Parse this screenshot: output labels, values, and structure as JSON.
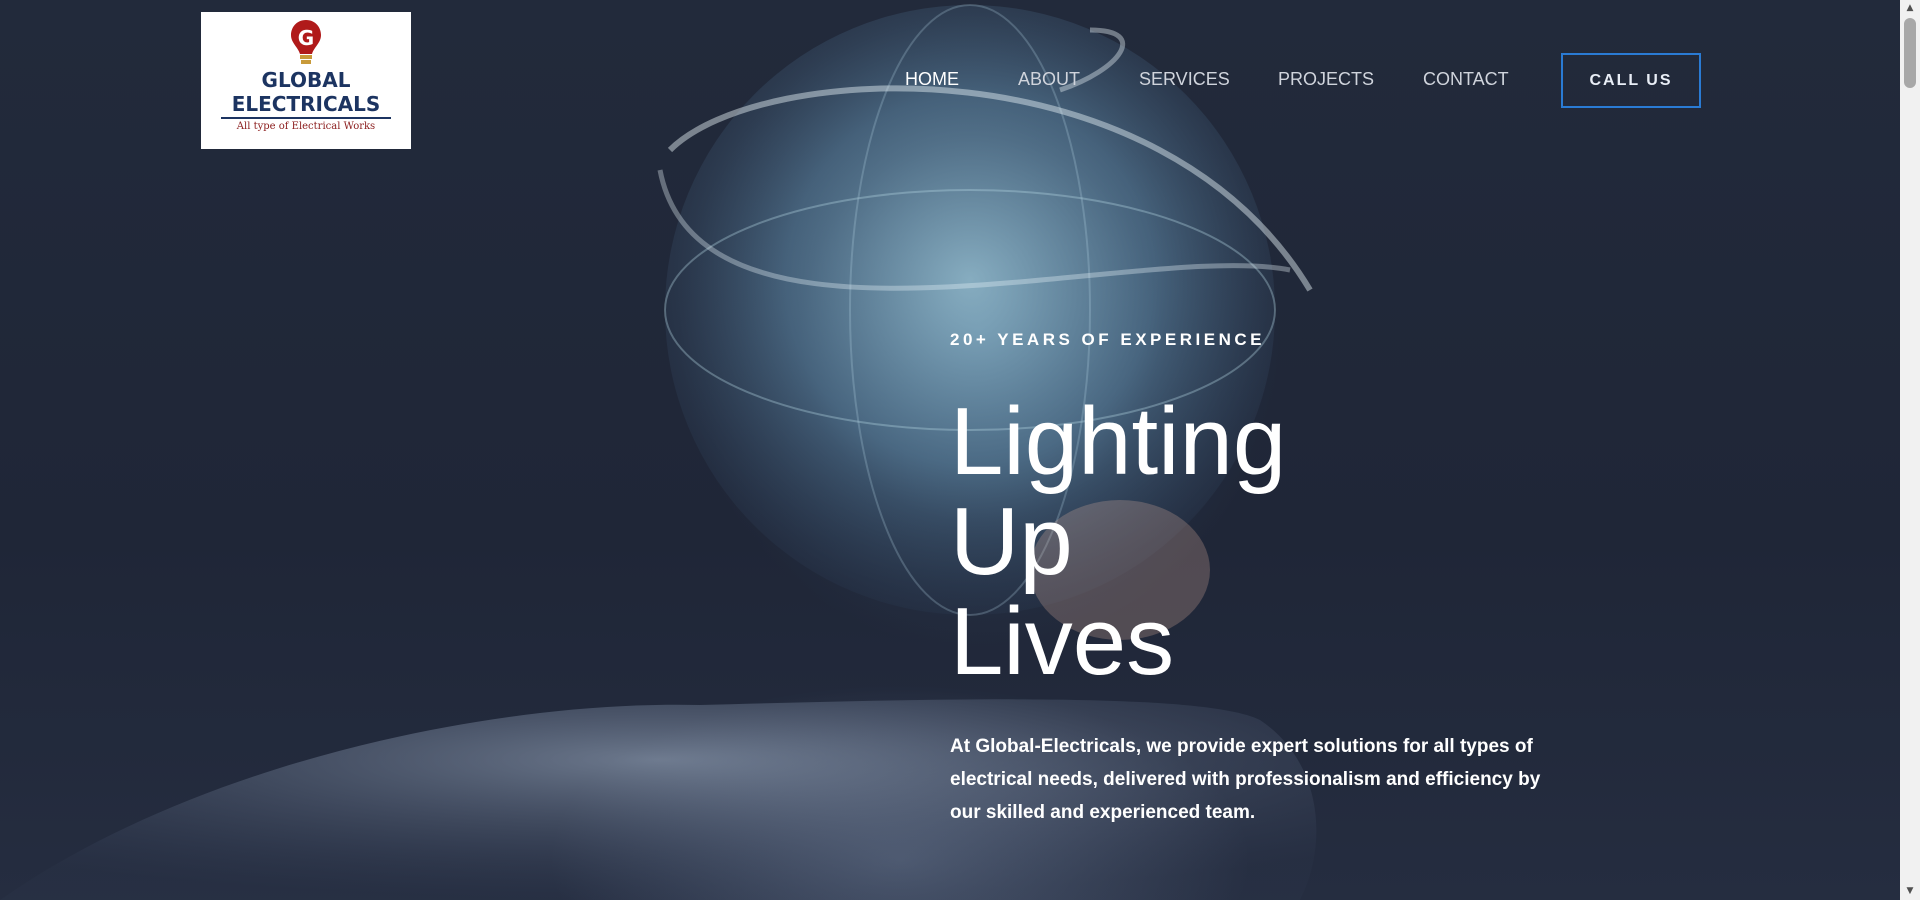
{
  "brand": {
    "name_line1": "GLOBAL",
    "name_line2": "ELECTRICALS",
    "tagline": "All type of Electrical Works",
    "logo_icon": "lightbulb-g-icon",
    "colors": {
      "primary": "#1c3461",
      "accent": "#b01a1a",
      "bulb_base": "#c89a3a"
    }
  },
  "nav": {
    "items": [
      {
        "label": "HOME",
        "active": true
      },
      {
        "label": "ABOUT",
        "active": false
      },
      {
        "label": "SERVICES",
        "active": false
      },
      {
        "label": "PROJECTS",
        "active": false
      },
      {
        "label": "CONTACT",
        "active": false
      }
    ],
    "cta_label": "CALL US",
    "cta_border_color": "#2a7bd4"
  },
  "hero": {
    "eyebrow": "20+ YEARS OF EXPERIENCE",
    "headline": [
      "Lighting",
      "Up",
      "Lives"
    ],
    "description": "At Global-Electricals, we provide expert solutions for all types of electrical needs, delivered with professionalism and efficiency by our skilled and experienced team.",
    "background_image": "glowing-globe-on-hand",
    "overlay_color": "#1f2536"
  }
}
